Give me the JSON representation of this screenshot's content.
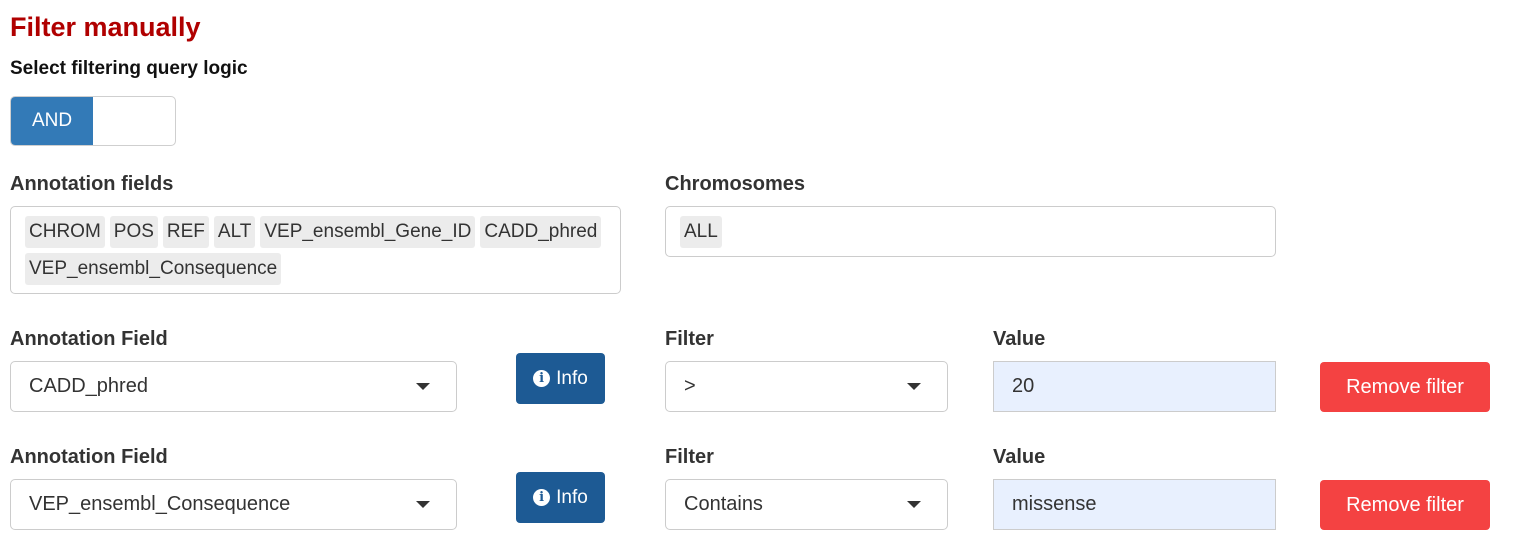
{
  "header": {
    "title": "Filter manually",
    "query_logic_label": "Select filtering query logic"
  },
  "logic_toggle": {
    "on_label": "AND"
  },
  "annotation_fields": {
    "label": "Annotation fields",
    "tags": [
      "CHROM",
      "POS",
      "REF",
      "ALT",
      "VEP_ensembl_Gene_ID",
      "CADD_phred",
      "VEP_ensembl_Consequence"
    ]
  },
  "chromosomes": {
    "label": "Chromosomes",
    "tags": [
      "ALL"
    ]
  },
  "filters": [
    {
      "field_label": "Annotation Field",
      "field_value": "CADD_phred",
      "info_label": "Info",
      "filter_label": "Filter",
      "filter_value": ">",
      "value_label": "Value",
      "value": "20",
      "remove_label": "Remove filter"
    },
    {
      "field_label": "Annotation Field",
      "field_value": "VEP_ensembl_Consequence",
      "info_label": "Info",
      "filter_label": "Filter",
      "filter_value": "Contains",
      "value_label": "Value",
      "value": "missense",
      "remove_label": "Remove filter"
    }
  ],
  "colors": {
    "title": "#b00000",
    "toggle_on": "#337ab7",
    "info_button": "#1d5a94",
    "remove_button": "#f44242",
    "value_input_bg": "#e8f0fe"
  },
  "icons": {
    "info": "info-circle-icon",
    "dropdown": "caret-down-icon"
  }
}
